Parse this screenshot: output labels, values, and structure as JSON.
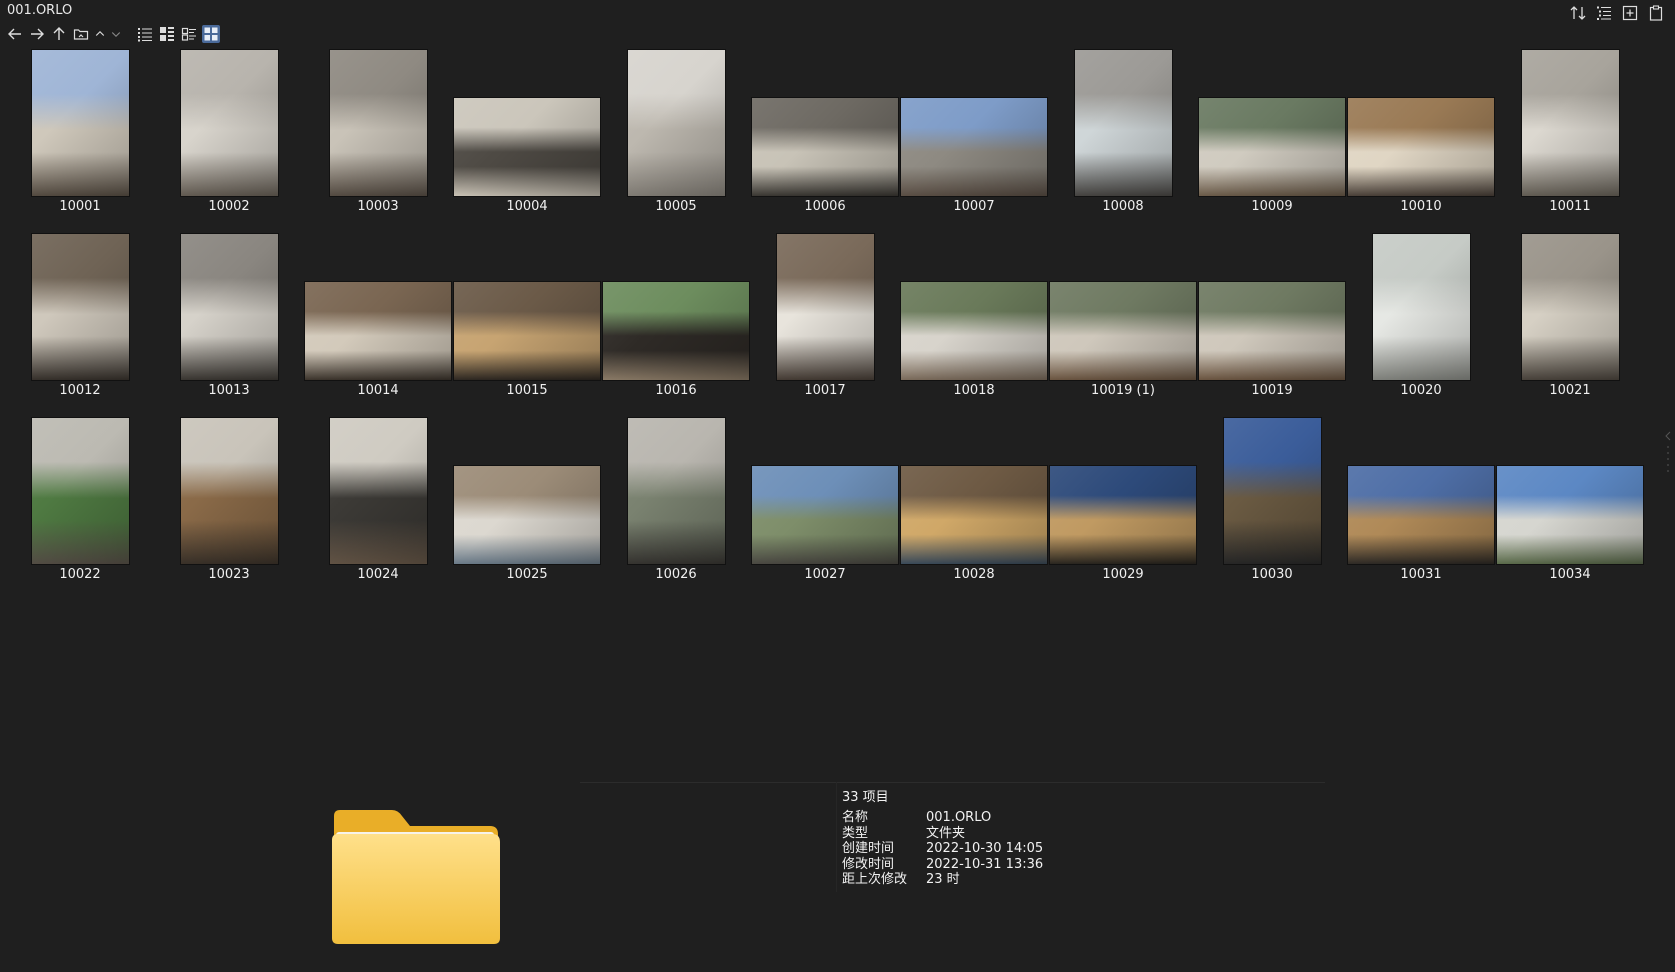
{
  "window": {
    "title": "001.ORLO"
  },
  "toolbar": {
    "left": [
      {
        "name": "back-button",
        "icon": "arrow-left-icon"
      },
      {
        "name": "forward-button",
        "icon": "arrow-right-icon"
      },
      {
        "name": "up-button",
        "icon": "arrow-up-icon"
      },
      {
        "name": "open-folder-button",
        "icon": "folder-open-icon"
      },
      {
        "name": "expand-up-button",
        "icon": "chevron-up-icon"
      },
      {
        "name": "expand-down-button",
        "icon": "chevron-down-icon"
      },
      {
        "name": "view-list-button",
        "icon": "list-icon"
      },
      {
        "name": "view-details-button",
        "icon": "details-icon"
      },
      {
        "name": "view-tiles-button",
        "icon": "tiles-icon"
      },
      {
        "name": "view-thumbnails-button",
        "icon": "grid-icon",
        "active": true
      }
    ],
    "right": [
      {
        "name": "sort-button",
        "icon": "sort-icon"
      },
      {
        "name": "group-button",
        "icon": "tree-list-icon"
      },
      {
        "name": "new-button",
        "icon": "plus-box-icon"
      },
      {
        "name": "clipboard-button",
        "icon": "clipboard-icon"
      }
    ]
  },
  "thumbnails": [
    {
      "label": "10001",
      "palette": [
        "#9fb5d6",
        "#cfc8bb",
        "#5a5045"
      ]
    },
    {
      "label": "10002",
      "palette": [
        "#b8b4ad",
        "#d8d4cc",
        "#6a6258"
      ]
    },
    {
      "label": "10003",
      "palette": [
        "#8f8a82",
        "#c9c3b8",
        "#5b5147"
      ]
    },
    {
      "label": "10004",
      "palette": [
        "#cbc6bb",
        "#4e4a44",
        "#c9c2b5"
      ]
    },
    {
      "label": "10005",
      "palette": [
        "#d7d4ce",
        "#bdb8af",
        "#8b867e"
      ]
    },
    {
      "label": "10006",
      "palette": [
        "#6e6a63",
        "#c8c3b7",
        "#3a3732"
      ]
    },
    {
      "label": "10007",
      "palette": [
        "#7e9cc8",
        "#8e8a82",
        "#5a4e44"
      ]
    },
    {
      "label": "10008",
      "palette": [
        "#9c9a96",
        "#cfd6d8",
        "#4a4845"
      ]
    },
    {
      "label": "10009",
      "palette": [
        "#6a7a62",
        "#d0cbc0",
        "#6a5a48"
      ]
    },
    {
      "label": "10010",
      "palette": [
        "#9a7a55",
        "#e0d6c4",
        "#4a4038"
      ]
    },
    {
      "label": "10011",
      "palette": [
        "#a8a49c",
        "#dcd8d0",
        "#6a645a"
      ]
    },
    {
      "label": "10012",
      "palette": [
        "#6f6355",
        "#cfc8bc",
        "#3a342e"
      ]
    },
    {
      "label": "10013",
      "palette": [
        "#8a8680",
        "#d6d2ca",
        "#3e3a35"
      ]
    },
    {
      "label": "10014",
      "palette": [
        "#7a6652",
        "#d3cabb",
        "#3c342c"
      ]
    },
    {
      "label": "10015",
      "palette": [
        "#6b5a48",
        "#c7a472",
        "#2e2822"
      ]
    },
    {
      "label": "10016",
      "palette": [
        "#6d8d5e",
        "#2e2a26",
        "#8a7a66"
      ]
    },
    {
      "label": "10017",
      "palette": [
        "#7a6a5a",
        "#e8e4dc",
        "#4a4038"
      ]
    },
    {
      "label": "10018",
      "palette": [
        "#6a7a5a",
        "#d8d4cc",
        "#7a6a5a"
      ]
    },
    {
      "label": "10019 (1)",
      "palette": [
        "#6f7a62",
        "#cfc8bc",
        "#6a5440"
      ]
    },
    {
      "label": "10019",
      "palette": [
        "#6f7a62",
        "#cfc8bc",
        "#6a5440"
      ]
    },
    {
      "label": "10020",
      "palette": [
        "#c6cbc6",
        "#e6e8e4",
        "#8a8c86"
      ]
    },
    {
      "label": "10021",
      "palette": [
        "#9a948a",
        "#d6d0c4",
        "#4e473f"
      ]
    },
    {
      "label": "10022",
      "palette": [
        "#bcbab2",
        "#4f7a42",
        "#5a534a"
      ]
    },
    {
      "label": "10023",
      "palette": [
        "#c9c4ba",
        "#8a6a48",
        "#3e352c"
      ]
    },
    {
      "label": "10024",
      "palette": [
        "#cfcbc2",
        "#3c3a36",
        "#6a5a4a"
      ]
    },
    {
      "label": "10025",
      "palette": [
        "#9c8c78",
        "#dcd8d0",
        "#6a7a88"
      ]
    },
    {
      "label": "10026",
      "palette": [
        "#b9b6af",
        "#7a8270",
        "#3a3834"
      ]
    },
    {
      "label": "10027",
      "palette": [
        "#6d8fb8",
        "#7e8e6a",
        "#4a4842"
      ]
    },
    {
      "label": "10028",
      "palette": [
        "#6e5a44",
        "#d0a868",
        "#3a4a5a"
      ]
    },
    {
      "label": "10029",
      "palette": [
        "#2d4a7a",
        "#c09a62",
        "#2a2620"
      ]
    },
    {
      "label": "10030",
      "palette": [
        "#3b5d9a",
        "#6a5a42",
        "#2a2a2a"
      ]
    },
    {
      "label": "10031",
      "palette": [
        "#4e6ea6",
        "#b08a58",
        "#2e2a26"
      ]
    },
    {
      "label": "10034",
      "palette": [
        "#5c88c4",
        "#d6d6d0",
        "#5a6a4a"
      ]
    }
  ],
  "details": {
    "count": "33 项目",
    "rows": [
      {
        "label": "名称",
        "value": "001.ORLO"
      },
      {
        "label": "类型",
        "value": "文件夹"
      },
      {
        "label": "创建时间",
        "value": "2022-10-30  14:05"
      },
      {
        "label": "修改时间",
        "value": "2022-10-31  13:36"
      },
      {
        "label": "距上次修改",
        "value": "23 时"
      }
    ]
  },
  "colors": {
    "background": "#1f1f1f",
    "folder": "#f5c84c",
    "accent": "#4a6a9a"
  }
}
